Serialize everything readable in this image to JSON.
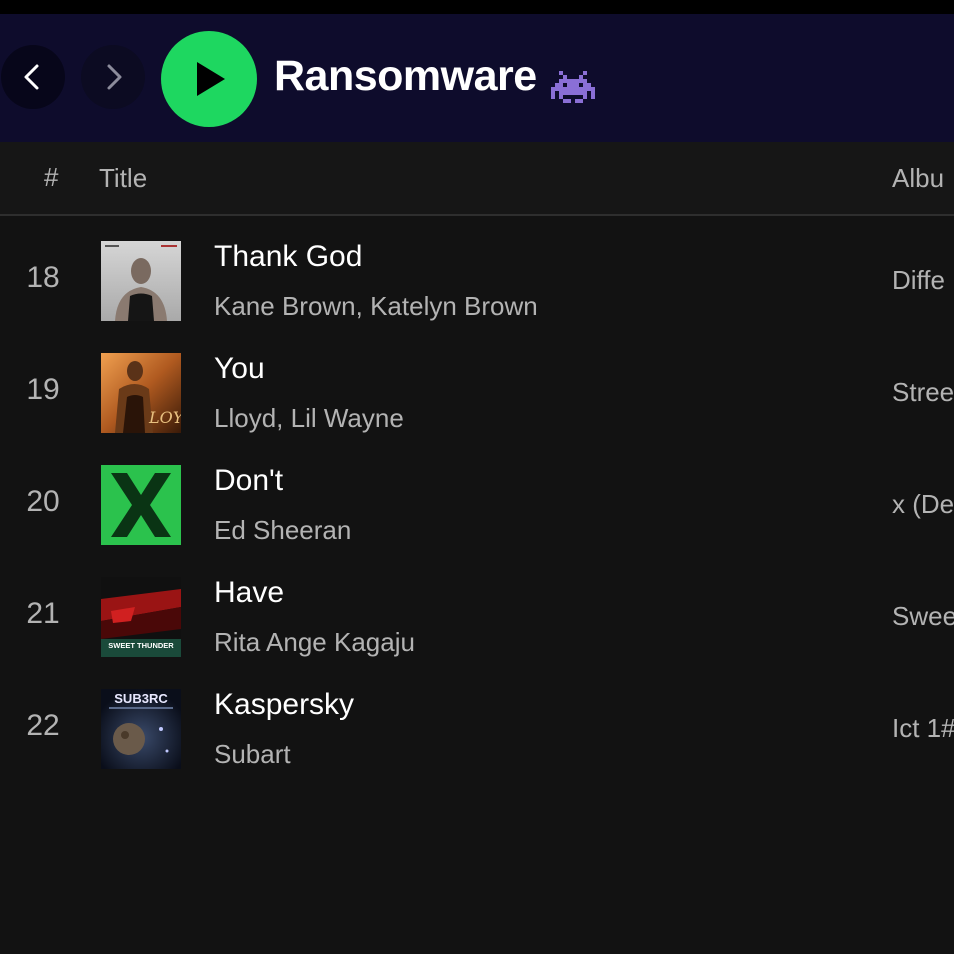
{
  "header": {
    "back_icon": "chevron-left-icon",
    "forward_icon": "chevron-right-icon",
    "play_icon": "play-icon",
    "playlist_title": "Ransomware",
    "title_emoji": "alien-monster-icon",
    "colors": {
      "header_bg": "#0e0c2c",
      "play_green": "#1ed760",
      "emoji_purple": "#8a6fd6"
    }
  },
  "table_header": {
    "index": "#",
    "title": "Title",
    "album": "Albu"
  },
  "tracks": [
    {
      "number": "18",
      "title": "Thank God",
      "artists": "Kane Brown, Katelyn Brown",
      "album": "Diffe",
      "art_icon": "album-art-thank-god"
    },
    {
      "number": "19",
      "title": "You",
      "artists": "Lloyd, Lil Wayne",
      "album": "Stree",
      "art_icon": "album-art-street-love"
    },
    {
      "number": "20",
      "title": "Don't",
      "artists": "Ed Sheeran",
      "album": "x (De",
      "art_icon": "album-art-x"
    },
    {
      "number": "21",
      "title": "Have",
      "artists": "Rita Ange Kagaju",
      "album": "Swee",
      "art_icon": "album-art-sweet-thunder"
    },
    {
      "number": "22",
      "title": "Kaspersky",
      "artists": "Subart",
      "album": "Ict 1#",
      "art_icon": "album-art-subarc"
    }
  ],
  "album_art_text": {
    "sweet_thunder": "SWEET THUNDER",
    "subarc": "SUB3RC"
  }
}
